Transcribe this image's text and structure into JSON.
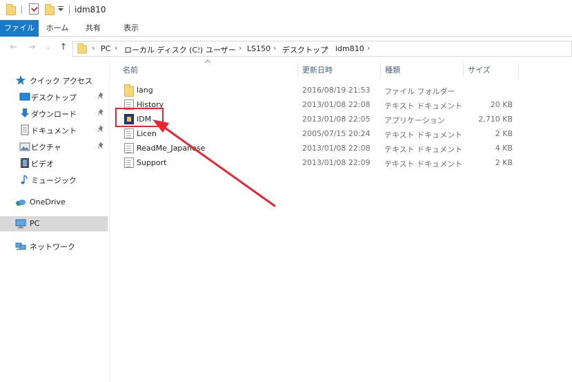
{
  "window": {
    "title": "idm810"
  },
  "ribbon": {
    "tabs": [
      "ファイル",
      "ホーム",
      "共有",
      "表示"
    ]
  },
  "nav_buttons": {
    "back": "←",
    "forward": "→",
    "recent": "⌄",
    "up": "↑"
  },
  "address": {
    "crumbs": [
      "PC",
      "ローカル ディスク (C:)",
      "ユーザー",
      "LS150",
      "デスクトップ",
      "idm810"
    ],
    "separator": "›"
  },
  "navpane": {
    "items": [
      {
        "label": "クイック アクセス",
        "icon": "star-icon",
        "pinned": false
      },
      {
        "label": "デスクトップ",
        "icon": "desktop-icon",
        "pinned": true
      },
      {
        "label": "ダウンロード",
        "icon": "download-icon",
        "pinned": true
      },
      {
        "label": "ドキュメント",
        "icon": "document-icon",
        "pinned": true
      },
      {
        "label": "ピクチャ",
        "icon": "pictures-icon",
        "pinned": true
      },
      {
        "label": "ビデオ",
        "icon": "video-icon",
        "pinned": false
      },
      {
        "label": "ミュージック",
        "icon": "music-icon",
        "pinned": false
      },
      {
        "label": "OneDrive",
        "icon": "onedrive-icon",
        "pinned": false
      },
      {
        "label": "PC",
        "icon": "pc-icon",
        "pinned": false,
        "selected": true
      },
      {
        "label": "ネットワーク",
        "icon": "network-icon",
        "pinned": false
      }
    ]
  },
  "columns": {
    "name": "名前",
    "date": "更新日時",
    "type": "種類",
    "size": "サイズ"
  },
  "files": [
    {
      "name": "lang",
      "date": "2016/08/19 21:53",
      "type": "ファイル フォルダー",
      "size": "",
      "icon": "folder-icon"
    },
    {
      "name": "History",
      "date": "2013/01/08 22:08",
      "type": "テキスト ドキュメント",
      "size": "20 KB",
      "icon": "text-file-icon"
    },
    {
      "name": "IDM",
      "date": "2013/01/08 22:05",
      "type": "アプリケーション",
      "size": "2,710 KB",
      "icon": "application-icon"
    },
    {
      "name": "Licen",
      "date": "2005/07/15 20:24",
      "type": "テキスト ドキュメント",
      "size": "2 KB",
      "icon": "text-file-icon"
    },
    {
      "name": "ReadMe_Japanese",
      "date": "2013/01/08 22:08",
      "type": "テキスト ドキュメント",
      "size": "4 KB",
      "icon": "text-file-icon"
    },
    {
      "name": "Support",
      "date": "2013/01/08 22:09",
      "type": "テキスト ドキュメント",
      "size": "2 KB",
      "icon": "text-file-icon"
    }
  ],
  "colors": {
    "accent": "#1979ca",
    "annotation": "#e8262e",
    "selected_nav": "#d9d9d9"
  }
}
